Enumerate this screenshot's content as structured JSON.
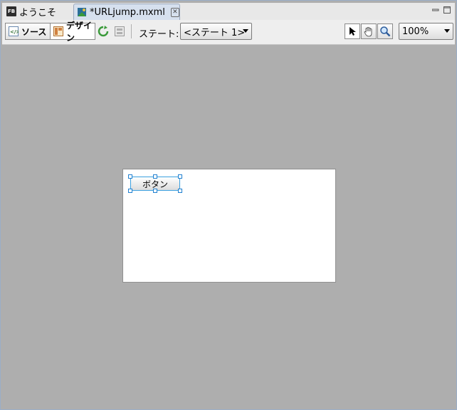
{
  "tabs": [
    {
      "label": "ようこそ",
      "icon": "flash-builder-icon",
      "icon_text": "FB",
      "active": false
    },
    {
      "label": "*URLjump.mxml",
      "icon": "mxml-file-icon",
      "active": true,
      "close": "close-icon"
    }
  ],
  "window_controls": [
    "minimize-icon",
    "maximize-icon"
  ],
  "toolbar": {
    "source_label": "ソース",
    "design_label": "デザイン",
    "refresh_icon": "refresh-icon",
    "layout_icon": "layout-icon",
    "state_label": "ステート:",
    "state_value": "<ステート 1>",
    "tools": [
      "select-arrow-icon",
      "pan-hand-icon",
      "zoom-magnifier-icon"
    ],
    "zoom_value": "100%"
  },
  "canvas": {
    "button_label": "ボタン"
  },
  "colors": {
    "editor_bg": "#aeaeae",
    "selection": "#3aa0e0",
    "refresh_green": "#3a9a3a"
  }
}
